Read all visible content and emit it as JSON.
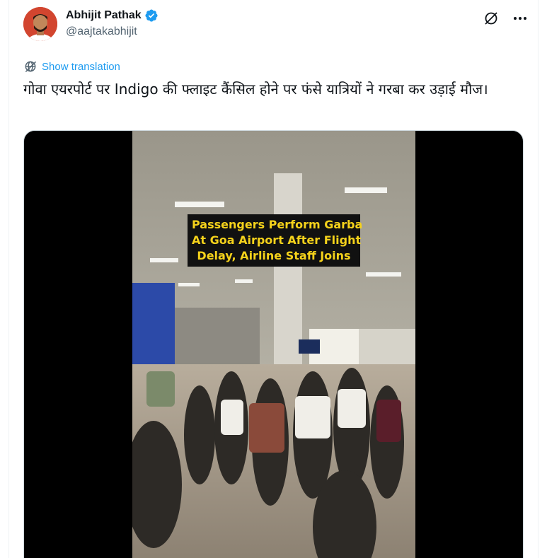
{
  "author": {
    "display_name": "Abhijit Pathak",
    "handle": "@aajtakabhijit",
    "verified": true
  },
  "actions": {
    "grok_icon": "grok-icon",
    "more_icon": "more-icon"
  },
  "translation": {
    "label": "Show translation"
  },
  "tweet": {
    "text": "गोवा एयरपोर्ट पर Indigo की फ्लाइट कैंसिल होने पर फंसे यात्रियों ने गरबा कर उड़ाई मौज।"
  },
  "media": {
    "caption_lines": [
      "Passengers Perform Garba",
      "At Goa Airport After Flight",
      "Delay, Airline Staff Joins"
    ]
  },
  "colors": {
    "link_blue": "#1d9bf0",
    "verified_blue": "#1d9bf0",
    "caption_yellow": "#f5d21b",
    "secondary_text": "#536471"
  }
}
